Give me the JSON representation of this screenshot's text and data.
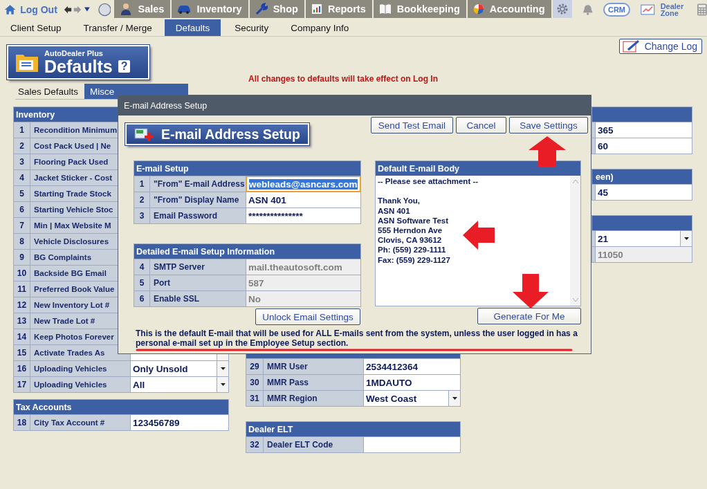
{
  "nav": {
    "logout": "Log Out",
    "modules": [
      {
        "label": "Sales",
        "selected": false
      },
      {
        "label": "Inventory",
        "selected": false
      },
      {
        "label": "Shop",
        "selected": false
      },
      {
        "label": "Reports",
        "selected": false
      },
      {
        "label": "Bookkeeping",
        "selected": false
      },
      {
        "label": "Accounting",
        "selected": false
      }
    ],
    "crm": "CRM",
    "dealer_zone": "Dealer Zone"
  },
  "subnav": [
    {
      "label": "Client Setup",
      "selected": false
    },
    {
      "label": "Transfer / Merge",
      "selected": false
    },
    {
      "label": "Defaults",
      "selected": true
    },
    {
      "label": "Security",
      "selected": false
    },
    {
      "label": "Company Info",
      "selected": false
    }
  ],
  "page_title": {
    "product": "AutoDealer Plus",
    "title": "Defaults",
    "help": "?"
  },
  "change_log": "Change Log",
  "notice": "All changes to defaults will take effect on Log In",
  "section_tabs": [
    {
      "label": "Sales Defaults",
      "selected": false
    },
    {
      "label": "Misce",
      "selected": true
    }
  ],
  "left_tables": [
    {
      "title": "Inventory",
      "rows": [
        {
          "num": "1",
          "label": "Recondition Minimum"
        },
        {
          "num": "2",
          "label": "Cost Pack Used | Ne"
        },
        {
          "num": "3",
          "label": "Flooring Pack Used"
        },
        {
          "num": "4",
          "label": "Jacket Sticker - Cost"
        },
        {
          "num": "5",
          "label": "Starting Trade Stock"
        },
        {
          "num": "6",
          "label": "Starting Vehicle Stoc"
        },
        {
          "num": "7",
          "label": "Min | Max Website M"
        },
        {
          "num": "8",
          "label": "Vehicle Disclosures"
        },
        {
          "num": "9",
          "label": "BG Complaints"
        },
        {
          "num": "10",
          "label": "Backside BG Email"
        },
        {
          "num": "11",
          "label": "Preferred Book Value"
        },
        {
          "num": "12",
          "label": "New Inventory Lot #"
        },
        {
          "num": "13",
          "label": "New Trade Lot #"
        },
        {
          "num": "14",
          "label": "Keep Photos Forever"
        },
        {
          "num": "15",
          "label": "Activate Trades As",
          "kind": "select"
        },
        {
          "num": "16",
          "label": "Uploading Vehicles",
          "value": "Only Unsold",
          "kind": "select"
        },
        {
          "num": "17",
          "label": "Uploading Vehicles",
          "value": "All",
          "kind": "select"
        }
      ]
    },
    {
      "title": "Tax Accounts",
      "rows": [
        {
          "num": "18",
          "label": "City Tax Account #",
          "value": "123456789",
          "kind": "input"
        }
      ]
    }
  ],
  "middle_tables": [
    {
      "rows": [
        {
          "num": "29",
          "label": "MMR User",
          "value": "2534412364",
          "kind": "input"
        },
        {
          "num": "30",
          "label": "MMR Pass",
          "value": "1MDAUTO",
          "kind": "input"
        },
        {
          "num": "31",
          "label": "MMR Region",
          "value": "West Coast",
          "kind": "select"
        }
      ]
    },
    {
      "title": "Dealer ELT",
      "rows": [
        {
          "num": "32",
          "label": "Dealer ELT Code",
          "kind": "input"
        }
      ]
    }
  ],
  "right_tables": [
    {
      "rows": [
        {
          "value": "365",
          "kind": "input"
        },
        {
          "value": "60",
          "kind": "input"
        }
      ]
    },
    {
      "title": "een)",
      "rows": [
        {
          "value": "45",
          "kind": "input"
        }
      ]
    },
    {
      "rows": [
        {
          "value": "21",
          "kind": "select"
        },
        {
          "value": "11050",
          "kind": "readonly"
        }
      ]
    }
  ],
  "dialog": {
    "title": "E-mail Address Setup",
    "heading": "E-mail Address Setup",
    "buttons": [
      "Send Test Email",
      "Cancel",
      "Save Settings"
    ],
    "email_setup": {
      "title": "E-mail Setup",
      "rows": [
        {
          "num": "1",
          "label": "\"From\" E-mail Address",
          "value": "webleads@asncars.com",
          "kind": "input",
          "focused": true
        },
        {
          "num": "2",
          "label": "\"From\" Display Name",
          "value": "ASN 401",
          "kind": "input",
          "focused": false
        },
        {
          "num": "3",
          "label": "Email Password",
          "value": "***************",
          "kind": "input",
          "focused": false
        }
      ]
    },
    "detailed": {
      "title": "Detailed E-mail Setup Information",
      "rows": [
        {
          "num": "4",
          "label": "SMTP Server",
          "value": "mail.theautosoft.com",
          "kind": "readonly"
        },
        {
          "num": "5",
          "label": "Port",
          "value": "587",
          "kind": "readonly"
        },
        {
          "num": "6",
          "label": "Enable SSL",
          "value": "No",
          "kind": "readonly"
        }
      ]
    },
    "unlock_button": "Unlock Email Settings",
    "body": {
      "title": "Default E-mail Body",
      "text": "-- Please see attachment --\n\nThank You,\nASN 401\nASN Software Test\n555 Herndon Ave\nClovis, CA 93612\nPh: (559) 229-1111\nFax: (559) 229-1127"
    },
    "generate_button": "Generate For Me",
    "footnote": "This is the default E-mail that will be used for ALL E-mails sent from the system, unless the user logged in has a personal e-mail set up in the Employee Setup section."
  }
}
